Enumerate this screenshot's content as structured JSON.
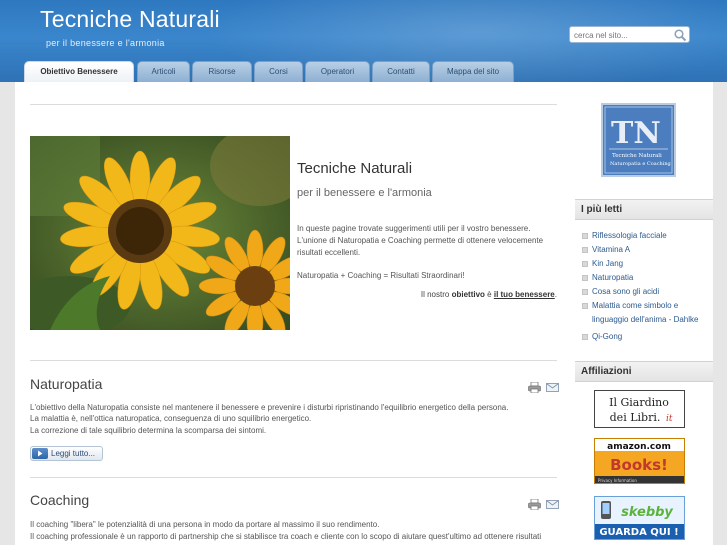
{
  "header": {
    "title": "Tecniche Naturali",
    "tagline": "per il benessere e l'armonia",
    "search_placeholder": "cerca nel sito..."
  },
  "tabs": [
    {
      "label": "Obiettivo Benessere",
      "active": true
    },
    {
      "label": "Articoli"
    },
    {
      "label": "Risorse"
    },
    {
      "label": "Corsi"
    },
    {
      "label": "Operatori"
    },
    {
      "label": "Contatti"
    },
    {
      "label": "Mappa del sito"
    }
  ],
  "intro": {
    "title": "Tecniche Naturali",
    "subtitle": "per il benessere e l'armonia",
    "line1": "In queste pagine trovate suggerimenti utili per il vostro benessere.",
    "line2": "L'unione di Naturopatia e Coaching permette di ottenere velocemente",
    "line3": "risultati eccellenti.",
    "formula": "Naturopatia + Coaching = Risultati Straordinari!",
    "goal_prefix": "Il nostro",
    "goal_word": "obiettivo",
    "goal_mid": "è",
    "goal_link": "il tuo benessere",
    "goal_end": "."
  },
  "sections": [
    {
      "title": "Naturopatia",
      "lines": [
        "L'obiettivo della Naturopatia consiste nel mantenere il benessere e prevenire i disturbi ripristinando l'equilibrio energetico della persona.",
        "La malattia è, nell'ottica naturopatica, conseguenza di uno squilibrio energetico.",
        "La correzione di tale squilibrio determina la scomparsa dei sintomi."
      ],
      "readmore": "Leggi tutto..."
    },
    {
      "title": "Coaching",
      "lines": [
        "Il coaching \"libera\" le potenzialità di una persona in modo da portare al massimo il suo rendimento.",
        "Il coaching professionale è un rapporto di partnership che si stabilisce tra coach e cliente con lo scopo di aiutare quest'ultimo ad ottenere risultati"
      ]
    }
  ],
  "sidebar": {
    "logo_text": "Tecniche Naturali",
    "logo_sub": "Naturopatia e Coaching",
    "most_read_title": "I più letti",
    "most_read": [
      "Riflessologia facciale",
      "Vitamina A",
      "Kin Jang",
      "Naturopatia",
      "Cosa sono gli acidi",
      "Malattia come simbolo e linguaggio dell'anima - Dahlke",
      "Qi-Gong"
    ],
    "affiliations_title": "Affiliazioni",
    "banner1_line1": "Il Giardino",
    "banner1_line2": "dei Libri.",
    "banner1_tld": "it",
    "banner2_brand": "amazon.com",
    "banner2_word": "Books!",
    "banner2_foot": "Privacy Information",
    "banner3_brand": "skebby",
    "banner3_cta": "GUARDA QUI !"
  },
  "colors": {
    "header_blue": "#3a86cc",
    "link_blue": "#2d5a8f",
    "amazon_orange": "#f5a623",
    "skebby_green": "#6cc04a"
  }
}
